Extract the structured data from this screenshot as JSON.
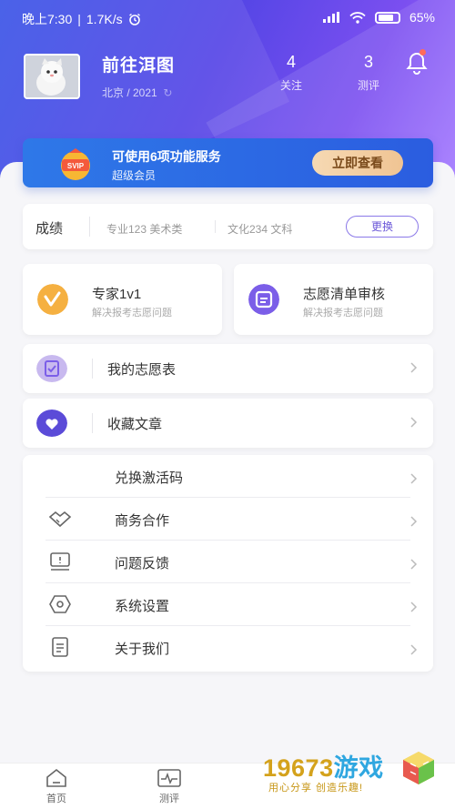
{
  "status_bar": {
    "time": "晚上7:30",
    "speed": "1.7K/s",
    "battery": "65"
  },
  "profile": {
    "name": "前往洱图",
    "location": "北京 / 2021"
  },
  "stats": [
    {
      "value": "4",
      "label": "关注"
    },
    {
      "value": "3",
      "label": "测评"
    }
  ],
  "vip": {
    "badge": "SVIP",
    "title": "可使用6项功能服务",
    "subtitle": "超级会员",
    "button": "立即查看"
  },
  "score": {
    "title": "成绩",
    "major": "专业123 美术类",
    "culture": "文化234 文科",
    "button": "更换"
  },
  "services": [
    {
      "title": "专家1v1",
      "subtitle": "解决报考志愿问题"
    },
    {
      "title": "志愿清单审核",
      "subtitle": "解决报考志愿问题"
    }
  ],
  "rows": [
    {
      "label": "我的志愿表"
    },
    {
      "label": "收藏文章"
    }
  ],
  "menu": [
    {
      "label": "兑换激活码"
    },
    {
      "label": "商务合作"
    },
    {
      "label": "问题反馈"
    },
    {
      "label": "系统设置"
    },
    {
      "label": "关于我们"
    }
  ],
  "tabs": [
    {
      "label": "首页"
    },
    {
      "label": "测评"
    }
  ],
  "watermark": {
    "number": "19673",
    "name": "游戏",
    "slogan": "用心分享 创造乐趣!"
  },
  "colors": {
    "accent": "#6b57d8",
    "vip_blue": "#2b5de0",
    "gold": "#f0c493"
  }
}
